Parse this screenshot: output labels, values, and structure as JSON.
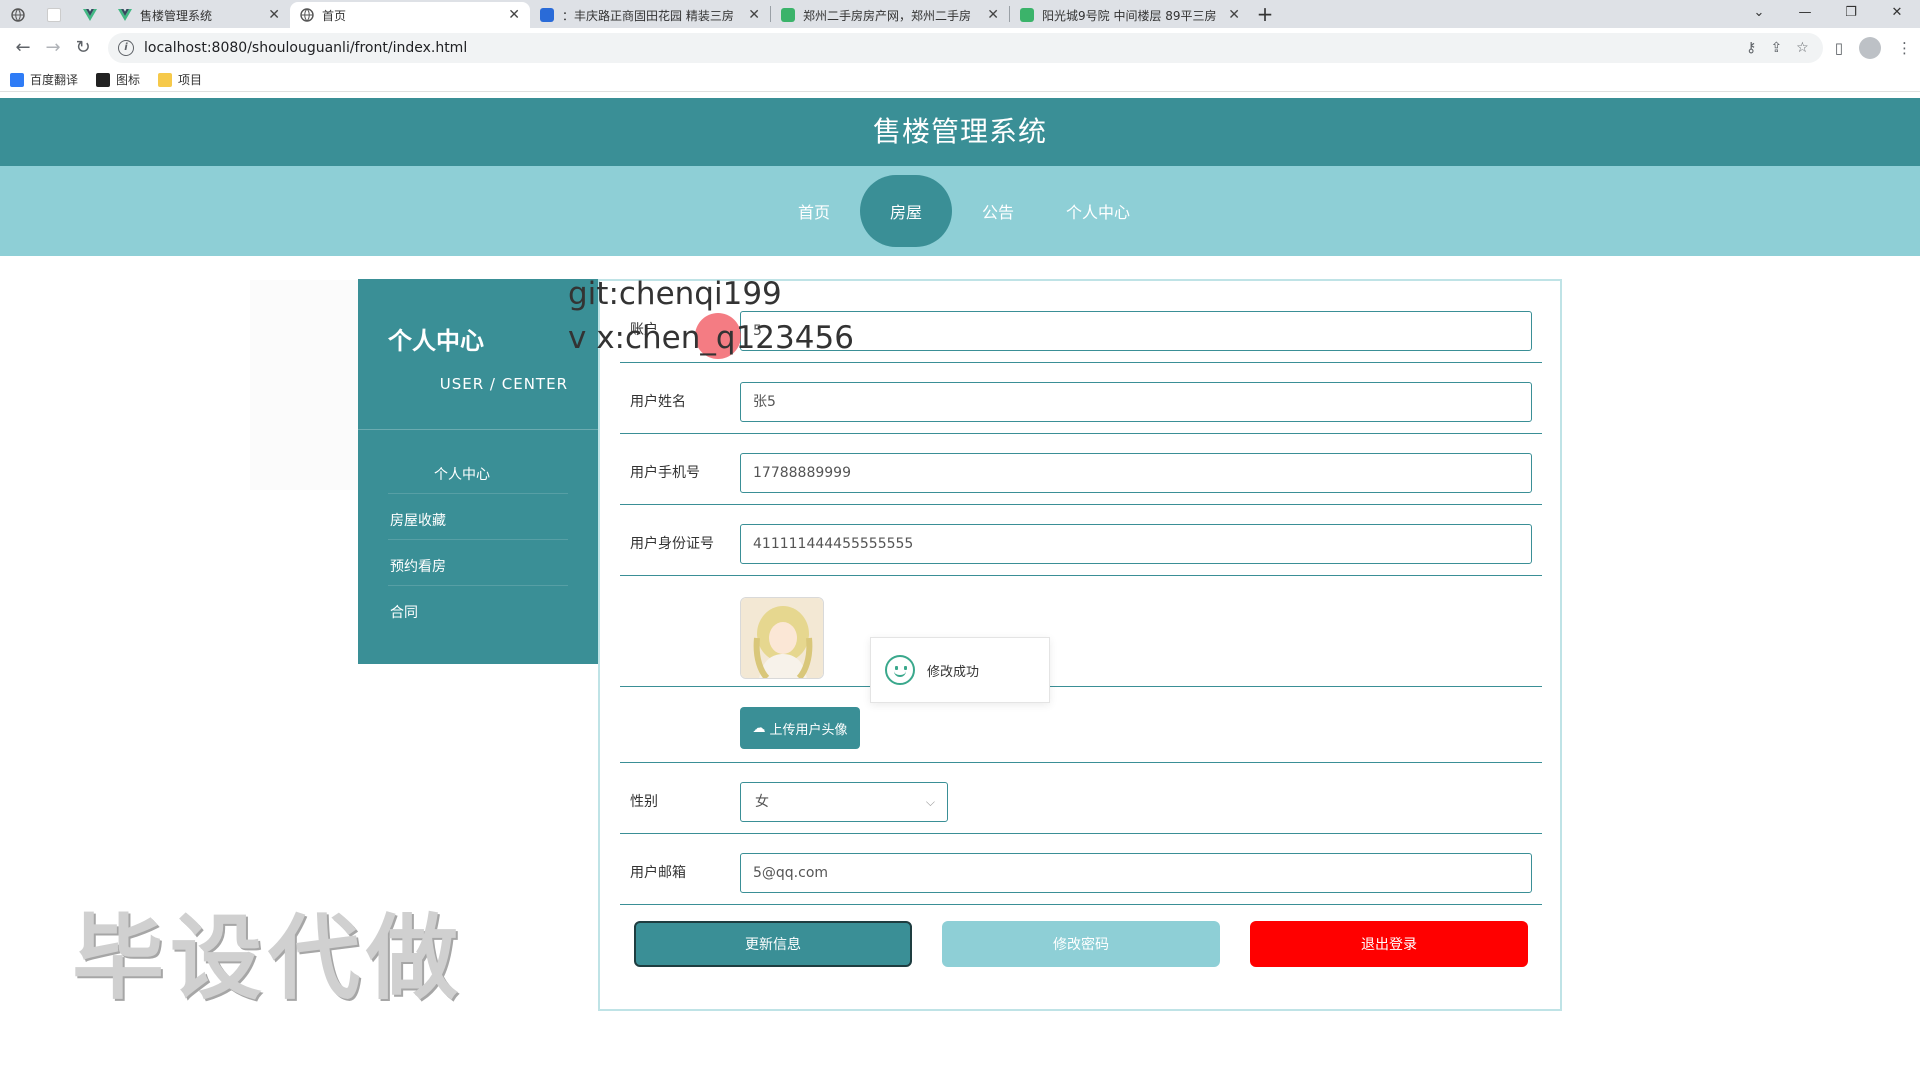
{
  "browser": {
    "tabs": [
      {
        "title": "",
        "pinned": true,
        "icon": "globe-icon"
      },
      {
        "title": "",
        "pinned": true,
        "icon": "blank-page-icon"
      },
      {
        "title": "",
        "pinned": true,
        "icon": "vue-logo-icon"
      },
      {
        "title": "售楼管理系统",
        "icon": "vue-logo-icon"
      },
      {
        "title": "首页",
        "icon": "globe-icon",
        "active": true
      },
      {
        "title": "：丰庆路正商固田花园 精装三房",
        "icon": "site-icon"
      },
      {
        "title": "郑州二手房房产网，郑州二手房",
        "icon": "house-icon"
      },
      {
        "title": "阳光城9号院 中间楼层 89平三房",
        "icon": "house-icon"
      }
    ],
    "url": "localhost:8080/shoulouguanli/front/index.html",
    "bookmarks": [
      {
        "label": "百度翻译",
        "icon": "translate-icon"
      },
      {
        "label": "图标",
        "icon": "image-icon"
      },
      {
        "label": "项目",
        "icon": "folder-icon"
      }
    ]
  },
  "site": {
    "title": "售楼管理系统",
    "nav": [
      "首页",
      "房屋",
      "公告",
      "个人中心"
    ],
    "nav_active": "房屋"
  },
  "sidebar": {
    "title": "个人中心",
    "subtitle": "USER / CENTER",
    "items": [
      "个人中心",
      "房屋收藏",
      "预约看房",
      "合同"
    ]
  },
  "form": {
    "account_label": "账户",
    "account_value": "5",
    "name_label": "用户姓名",
    "name_value": "张5",
    "phone_label": "用户手机号",
    "phone_value": "17788889999",
    "id_label": "用户身份证号",
    "id_value": "411111444455555555",
    "upload_label": "上传用户头像",
    "gender_label": "性别",
    "gender_value": "女",
    "email_label": "用户邮箱",
    "email_value": "5@qq.com",
    "buttons": {
      "update": "更新信息",
      "password": "修改密码",
      "logout": "退出登录"
    }
  },
  "toast": {
    "message": "修改成功"
  },
  "overlay": {
    "git": "git:chenqi199",
    "vx": "v x:chen_q123456",
    "watermark": "毕设代做"
  },
  "colors": {
    "primary": "#3a8f96",
    "light": "#8ecfd6",
    "danger": "#ff0000"
  }
}
